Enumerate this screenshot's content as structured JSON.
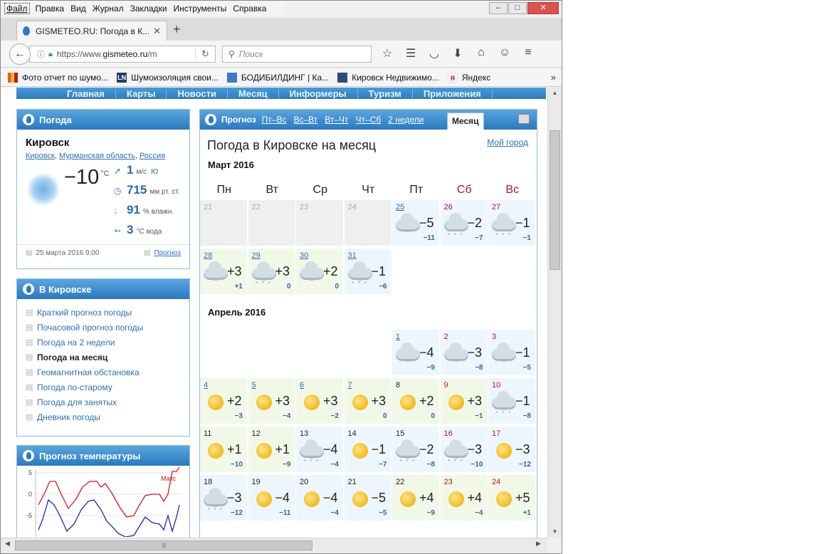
{
  "browser": {
    "menu": [
      "Файл",
      "Правка",
      "Вид",
      "Журнал",
      "Закладки",
      "Инструменты",
      "Справка"
    ],
    "tab_title": "GISMETEO.RU: Погода в К...",
    "url_prefix": "https://www.",
    "url_host": "gismeteo.ru",
    "url_path": "/m",
    "search_placeholder": "Поиск",
    "bookmarks": [
      "Фото отчет по шумо...",
      "Шумоизоляция свои...",
      "БОДИБИЛДИНГ | Ка...",
      "Кировск Недвижимо...",
      "Яндекс"
    ],
    "bookmark_icons": [
      "",
      "LN",
      "",
      "",
      "Я"
    ]
  },
  "site_nav": [
    "Главная",
    "Карты",
    "Новости",
    "Месяц",
    "Информеры",
    "Туризм",
    "Приложения"
  ],
  "weather": {
    "header": "Погода",
    "city": "Кировск",
    "region": [
      "Кировск",
      "Мурманская область",
      "Россия"
    ],
    "temp": "−10",
    "temp_unit": "°C",
    "wind": "1",
    "wind_unit": "м/с",
    "wind_dir": "Ю",
    "pressure": "715",
    "pressure_unit": "мм рт. ст.",
    "humidity": "91",
    "humidity_unit": "% влажн.",
    "water": "3",
    "water_unit": "°С вода",
    "updated": "25 марта 2016 9:00",
    "forecast_link": "Прогноз"
  },
  "in_city": {
    "header": "В Кировске",
    "links": [
      "Краткий прогноз погоды",
      "Почасовой прогноз погоды",
      "Погода на 2 недели",
      "Погода на месяц",
      "Геомагнитная обстановка",
      "Погода по-старому",
      "Погода для занятых",
      "Дневник погоды"
    ],
    "active_index": 3
  },
  "temp_forecast": {
    "header": "Прогноз температуры",
    "ticks": [
      "5",
      "0",
      "-5"
    ],
    "label_max": "Макс"
  },
  "forecast": {
    "label": "Прогноз",
    "tabs": [
      "Пт–Вс",
      "Вс–Вт",
      "Вт–Чт",
      "Чт–Сб",
      "2 недели"
    ],
    "active_tab": "Месяц",
    "title": "Погода в Кировске на месяц",
    "my_city": "Мой город",
    "dow": [
      "Пн",
      "Вт",
      "Ср",
      "Чт",
      "Пт",
      "Сб",
      "Вс"
    ],
    "months": [
      {
        "label": "Март 2016",
        "weeks": [
          [
            {
              "d": "21",
              "past": true
            },
            {
              "d": "22",
              "past": true
            },
            {
              "d": "23",
              "past": true
            },
            {
              "d": "24",
              "past": true
            },
            {
              "d": "25",
              "hi": "−5",
              "lo": "−11",
              "icon": "cloud-sun",
              "dclass": "lnk",
              "bg": "blue"
            },
            {
              "d": "26",
              "hi": "−2",
              "lo": "−7",
              "icon": "cloud-snow",
              "dclass": "we",
              "bg": "blue"
            },
            {
              "d": "27",
              "hi": "−1",
              "lo": "−1",
              "icon": "cloud-snow",
              "dclass": "we",
              "bg": "blue"
            }
          ],
          [
            {
              "d": "28",
              "hi": "+3",
              "lo": "+1",
              "icon": "cloud-sun",
              "dclass": "lnk",
              "bg": "green"
            },
            {
              "d": "29",
              "hi": "+3",
              "lo": "0",
              "icon": "cloud-sun-snow",
              "dclass": "lnk",
              "bg": "green"
            },
            {
              "d": "30",
              "hi": "+2",
              "lo": "0",
              "icon": "cloud-sun",
              "dclass": "lnk",
              "bg": "green"
            },
            {
              "d": "31",
              "hi": "−1",
              "lo": "−6",
              "icon": "cloud-sun-snow",
              "dclass": "lnk",
              "bg": "blue"
            }
          ]
        ]
      },
      {
        "label": "Апрель 2016",
        "weeks": [
          [
            null,
            null,
            null,
            null,
            {
              "d": "1",
              "hi": "−4",
              "lo": "−9",
              "icon": "cloud-sun",
              "dclass": "lnk",
              "bg": "blue"
            },
            {
              "d": "2",
              "hi": "−3",
              "lo": "−8",
              "icon": "cloud-sun",
              "dclass": "we",
              "bg": "blue"
            },
            {
              "d": "3",
              "hi": "−1",
              "lo": "−5",
              "icon": "cloud-sun",
              "dclass": "we",
              "bg": "blue"
            }
          ],
          [
            {
              "d": "4",
              "hi": "+2",
              "lo": "−3",
              "icon": "sun",
              "dclass": "lnk",
              "bg": "green"
            },
            {
              "d": "5",
              "hi": "+3",
              "lo": "−4",
              "icon": "sun",
              "dclass": "lnk",
              "bg": "green"
            },
            {
              "d": "6",
              "hi": "+3",
              "lo": "−2",
              "icon": "sun",
              "dclass": "lnk",
              "bg": "green"
            },
            {
              "d": "7",
              "hi": "+3",
              "lo": "0",
              "icon": "sun",
              "dclass": "lnk",
              "bg": "green"
            },
            {
              "d": "8",
              "hi": "+2",
              "lo": "0",
              "icon": "sun",
              "dclass": "plain",
              "bg": "green"
            },
            {
              "d": "9",
              "hi": "+3",
              "lo": "−1",
              "icon": "sun",
              "dclass": "we",
              "bg": "green"
            },
            {
              "d": "10",
              "hi": "−1",
              "lo": "−8",
              "icon": "cloud-sun-snow",
              "dclass": "we",
              "bg": "blue"
            }
          ],
          [
            {
              "d": "11",
              "hi": "+1",
              "lo": "−10",
              "icon": "sun",
              "dclass": "plain",
              "bg": "green"
            },
            {
              "d": "12",
              "hi": "+1",
              "lo": "−9",
              "icon": "sun",
              "dclass": "plain",
              "bg": "green"
            },
            {
              "d": "13",
              "hi": "−4",
              "lo": "−4",
              "icon": "cloud-sun-snow",
              "dclass": "plain",
              "bg": "blue"
            },
            {
              "d": "14",
              "hi": "−1",
              "lo": "−7",
              "icon": "sun",
              "dclass": "plain",
              "bg": "blue"
            },
            {
              "d": "15",
              "hi": "−2",
              "lo": "−8",
              "icon": "cloud-sun-snow",
              "dclass": "plain",
              "bg": "blue"
            },
            {
              "d": "16",
              "hi": "−3",
              "lo": "−10",
              "icon": "cloud-sun-snow",
              "dclass": "we",
              "bg": "blue"
            },
            {
              "d": "17",
              "hi": "−3",
              "lo": "−12",
              "icon": "sun",
              "dclass": "we",
              "bg": "blue"
            }
          ],
          [
            {
              "d": "18",
              "hi": "−3",
              "lo": "−12",
              "icon": "cloud-sun-snow",
              "dclass": "plain",
              "bg": "blue"
            },
            {
              "d": "19",
              "hi": "−4",
              "lo": "−11",
              "icon": "sun",
              "dclass": "plain",
              "bg": "blue"
            },
            {
              "d": "20",
              "hi": "−4",
              "lo": "−4",
              "icon": "sun",
              "dclass": "plain",
              "bg": "blue"
            },
            {
              "d": "21",
              "hi": "−5",
              "lo": "−5",
              "icon": "sun",
              "dclass": "plain",
              "bg": "blue"
            },
            {
              "d": "22",
              "hi": "+4",
              "lo": "−9",
              "icon": "sun",
              "dclass": "plain",
              "bg": "green"
            },
            {
              "d": "23",
              "hi": "+4",
              "lo": "−4",
              "icon": "sun",
              "dclass": "we",
              "bg": "green"
            },
            {
              "d": "24",
              "hi": "+5",
              "lo": "+1",
              "icon": "sun",
              "dclass": "we",
              "bg": "green"
            }
          ]
        ]
      }
    ]
  }
}
